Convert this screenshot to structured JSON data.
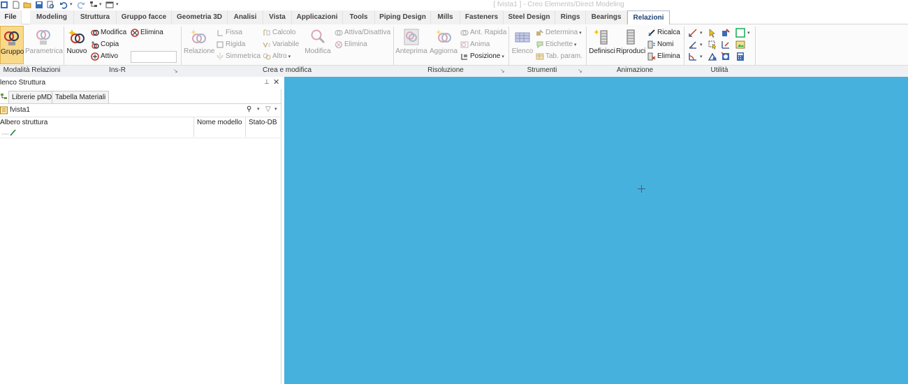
{
  "window": {
    "title": "[ fvista1 ] - Creo Elements/Direct Modeling"
  },
  "quick_access": {
    "icons": [
      "app-icon",
      "new-icon",
      "open-icon",
      "save-icon",
      "print-preview-icon",
      "undo-icon",
      "redo-icon",
      "settings-tree-icon",
      "window-icon"
    ]
  },
  "ribbon_tabs": [
    {
      "label": "File"
    },
    {
      "label": "Modeling"
    },
    {
      "label": "Struttura"
    },
    {
      "label": "Gruppo facce"
    },
    {
      "label": "Geometria 3D"
    },
    {
      "label": "Analisi"
    },
    {
      "label": "Vista"
    },
    {
      "label": "Applicazioni"
    },
    {
      "label": "Tools"
    },
    {
      "label": "Piping Design"
    },
    {
      "label": "Mills"
    },
    {
      "label": "Fasteners"
    },
    {
      "label": "Steel Design"
    },
    {
      "label": "Rings"
    },
    {
      "label": "Bearings"
    },
    {
      "label": "Relazioni"
    }
  ],
  "active_tab": "Relazioni",
  "ribbon": {
    "modalita": {
      "group_label": "Modalità Relazioni",
      "gruppo": "Gruppo",
      "parametrica": "Parametrica"
    },
    "ins_r": {
      "group_label": "Ins-R",
      "nuovo": "Nuovo",
      "modifica": "Modifica",
      "copia": "Copia",
      "attivo": "Attivo",
      "elimina": "Elimina",
      "input_value": ""
    },
    "crea": {
      "group_label": "Crea e modifica",
      "relazione": "Relazione",
      "fissa": "Fissa",
      "rigida": "Rigida",
      "simmetrica": "Simmetrica",
      "calcolo": "Calcolo",
      "variabile": "Variabile",
      "altro": "Altro",
      "modifica": "Modifica",
      "attiva_disattiva": "Attiva/Disattiva",
      "elimina": "Elimina"
    },
    "risoluzione": {
      "group_label": "Risoluzione",
      "anteprima": "Anteprima",
      "aggiorna": "Aggiorna",
      "ant_rapida": "Ant. Rapida",
      "anima": "Anima",
      "posizione": "Posizione"
    },
    "strumenti": {
      "group_label": "Strumenti",
      "elenco": "Elenco",
      "determina": "Determina",
      "etichette": "Etichette",
      "tab_param": "Tab. param."
    },
    "animazione": {
      "group_label": "Animazione",
      "definisci": "Definisci",
      "riproduci": "Riproduci",
      "ricalca": "Ricalca",
      "nomi": "Nomi",
      "elimina": "Elimina"
    },
    "utilita": {
      "group_label": "Utilità"
    }
  },
  "left_panel": {
    "title": "lenco Struttura",
    "tabs": [
      "Librerie pMD",
      "Tabella Materiali"
    ],
    "current_item": "fvista1",
    "columns": [
      "Albero struttura",
      "Nome modello",
      "Stato-DB"
    ]
  },
  "colors": {
    "viewport": "#47b1de",
    "active_tab_text": "#1f3f72",
    "pressed_button": "#f9d98a"
  }
}
